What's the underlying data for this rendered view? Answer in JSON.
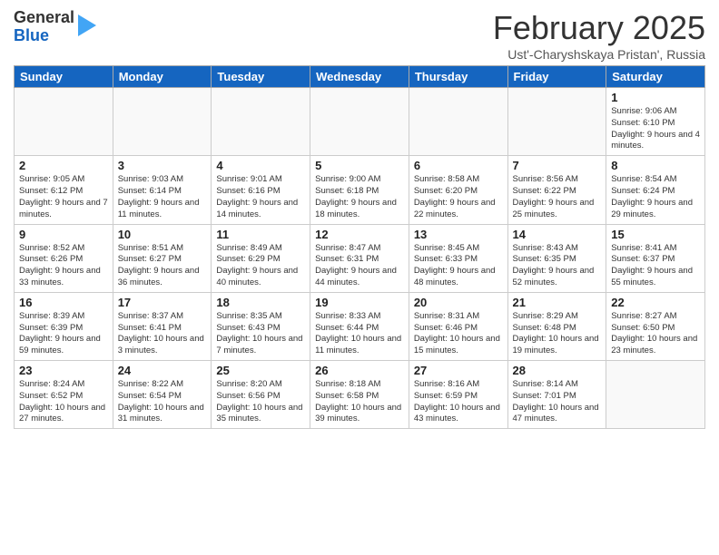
{
  "header": {
    "logo_line1": "General",
    "logo_line2": "Blue",
    "title": "February 2025",
    "location": "Ust'-Charyshskaya Pristan', Russia"
  },
  "weekdays": [
    "Sunday",
    "Monday",
    "Tuesday",
    "Wednesday",
    "Thursday",
    "Friday",
    "Saturday"
  ],
  "weeks": [
    [
      {
        "day": "",
        "info": ""
      },
      {
        "day": "",
        "info": ""
      },
      {
        "day": "",
        "info": ""
      },
      {
        "day": "",
        "info": ""
      },
      {
        "day": "",
        "info": ""
      },
      {
        "day": "",
        "info": ""
      },
      {
        "day": "1",
        "info": "Sunrise: 9:06 AM\nSunset: 6:10 PM\nDaylight: 9 hours and 4 minutes."
      }
    ],
    [
      {
        "day": "2",
        "info": "Sunrise: 9:05 AM\nSunset: 6:12 PM\nDaylight: 9 hours and 7 minutes."
      },
      {
        "day": "3",
        "info": "Sunrise: 9:03 AM\nSunset: 6:14 PM\nDaylight: 9 hours and 11 minutes."
      },
      {
        "day": "4",
        "info": "Sunrise: 9:01 AM\nSunset: 6:16 PM\nDaylight: 9 hours and 14 minutes."
      },
      {
        "day": "5",
        "info": "Sunrise: 9:00 AM\nSunset: 6:18 PM\nDaylight: 9 hours and 18 minutes."
      },
      {
        "day": "6",
        "info": "Sunrise: 8:58 AM\nSunset: 6:20 PM\nDaylight: 9 hours and 22 minutes."
      },
      {
        "day": "7",
        "info": "Sunrise: 8:56 AM\nSunset: 6:22 PM\nDaylight: 9 hours and 25 minutes."
      },
      {
        "day": "8",
        "info": "Sunrise: 8:54 AM\nSunset: 6:24 PM\nDaylight: 9 hours and 29 minutes."
      }
    ],
    [
      {
        "day": "9",
        "info": "Sunrise: 8:52 AM\nSunset: 6:26 PM\nDaylight: 9 hours and 33 minutes."
      },
      {
        "day": "10",
        "info": "Sunrise: 8:51 AM\nSunset: 6:27 PM\nDaylight: 9 hours and 36 minutes."
      },
      {
        "day": "11",
        "info": "Sunrise: 8:49 AM\nSunset: 6:29 PM\nDaylight: 9 hours and 40 minutes."
      },
      {
        "day": "12",
        "info": "Sunrise: 8:47 AM\nSunset: 6:31 PM\nDaylight: 9 hours and 44 minutes."
      },
      {
        "day": "13",
        "info": "Sunrise: 8:45 AM\nSunset: 6:33 PM\nDaylight: 9 hours and 48 minutes."
      },
      {
        "day": "14",
        "info": "Sunrise: 8:43 AM\nSunset: 6:35 PM\nDaylight: 9 hours and 52 minutes."
      },
      {
        "day": "15",
        "info": "Sunrise: 8:41 AM\nSunset: 6:37 PM\nDaylight: 9 hours and 55 minutes."
      }
    ],
    [
      {
        "day": "16",
        "info": "Sunrise: 8:39 AM\nSunset: 6:39 PM\nDaylight: 9 hours and 59 minutes."
      },
      {
        "day": "17",
        "info": "Sunrise: 8:37 AM\nSunset: 6:41 PM\nDaylight: 10 hours and 3 minutes."
      },
      {
        "day": "18",
        "info": "Sunrise: 8:35 AM\nSunset: 6:43 PM\nDaylight: 10 hours and 7 minutes."
      },
      {
        "day": "19",
        "info": "Sunrise: 8:33 AM\nSunset: 6:44 PM\nDaylight: 10 hours and 11 minutes."
      },
      {
        "day": "20",
        "info": "Sunrise: 8:31 AM\nSunset: 6:46 PM\nDaylight: 10 hours and 15 minutes."
      },
      {
        "day": "21",
        "info": "Sunrise: 8:29 AM\nSunset: 6:48 PM\nDaylight: 10 hours and 19 minutes."
      },
      {
        "day": "22",
        "info": "Sunrise: 8:27 AM\nSunset: 6:50 PM\nDaylight: 10 hours and 23 minutes."
      }
    ],
    [
      {
        "day": "23",
        "info": "Sunrise: 8:24 AM\nSunset: 6:52 PM\nDaylight: 10 hours and 27 minutes."
      },
      {
        "day": "24",
        "info": "Sunrise: 8:22 AM\nSunset: 6:54 PM\nDaylight: 10 hours and 31 minutes."
      },
      {
        "day": "25",
        "info": "Sunrise: 8:20 AM\nSunset: 6:56 PM\nDaylight: 10 hours and 35 minutes."
      },
      {
        "day": "26",
        "info": "Sunrise: 8:18 AM\nSunset: 6:58 PM\nDaylight: 10 hours and 39 minutes."
      },
      {
        "day": "27",
        "info": "Sunrise: 8:16 AM\nSunset: 6:59 PM\nDaylight: 10 hours and 43 minutes."
      },
      {
        "day": "28",
        "info": "Sunrise: 8:14 AM\nSunset: 7:01 PM\nDaylight: 10 hours and 47 minutes."
      },
      {
        "day": "",
        "info": ""
      }
    ]
  ]
}
